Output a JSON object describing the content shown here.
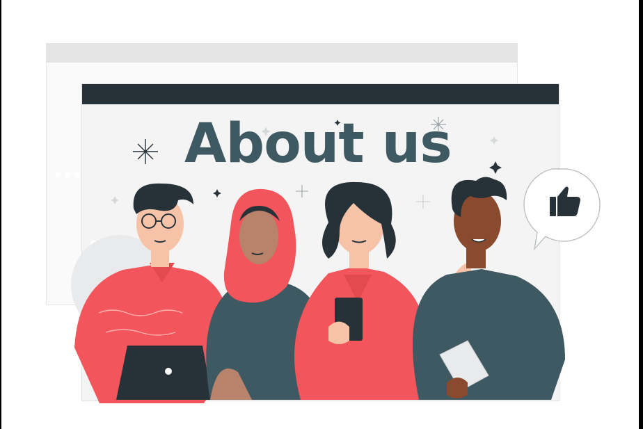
{
  "headline": "About us",
  "colors": {
    "accent": "#F2555B",
    "dark": "#263238",
    "headline": "#3F5962"
  },
  "icons": [
    "thumbs-up-icon",
    "sparkle-icon"
  ]
}
